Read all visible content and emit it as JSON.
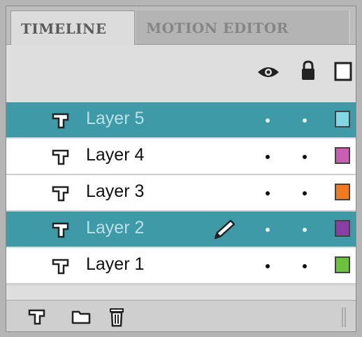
{
  "tabs": [
    {
      "label": "TIMELINE"
    },
    {
      "label": "MOTION EDITOR"
    }
  ],
  "header": {
    "icons": [
      "eye-icon",
      "lock-icon",
      "outline-icon"
    ]
  },
  "layers": [
    {
      "name": "Layer 5",
      "selected": true,
      "editing": false,
      "color": "#7fd8e4"
    },
    {
      "name": "Layer 4",
      "selected": false,
      "editing": false,
      "color": "#c85fb4"
    },
    {
      "name": "Layer 3",
      "selected": false,
      "editing": false,
      "color": "#f07a1e"
    },
    {
      "name": "Layer 2",
      "selected": true,
      "editing": true,
      "color": "#8a3fa8"
    },
    {
      "name": "Layer 1",
      "selected": false,
      "editing": false,
      "color": "#6cc23c"
    }
  ],
  "footer": {
    "icons": [
      "new-layer-icon",
      "new-folder-icon",
      "delete-icon"
    ]
  },
  "colors": {
    "selection": "#3d9aa6",
    "panel": "#d6d6d6"
  }
}
